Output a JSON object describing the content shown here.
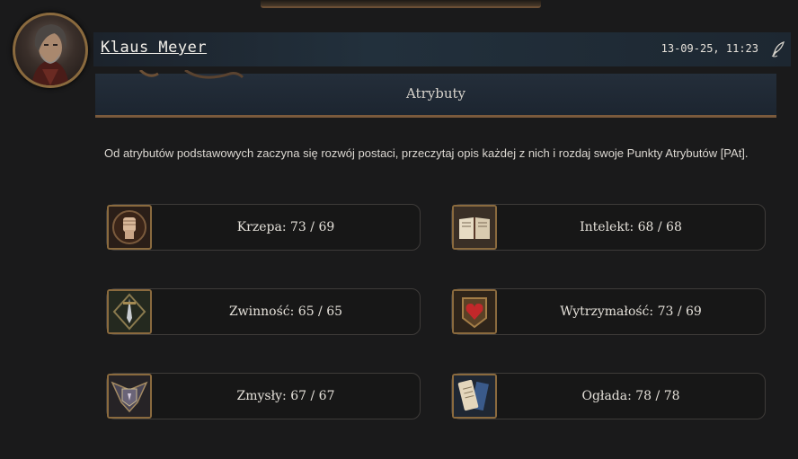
{
  "post": {
    "author": "Klaus Meyer",
    "date": "13-09-25, 11:23"
  },
  "section": {
    "title": "Atrybuty"
  },
  "description": "Od atrybutów podstawowych zaczyna się rozwój postaci, przeczytaj opis każdej z nich i rozdaj swoje Punkty Atrybutów [PAt].",
  "attributes": [
    {
      "label": "Krzepa: 73 / 69",
      "icon": "fist-icon"
    },
    {
      "label": "Intelekt: 68 / 68",
      "icon": "book-icon"
    },
    {
      "label": "Zwinność: 65 / 65",
      "icon": "sword-icon"
    },
    {
      "label": "Wytrzymałość: 73 / 69",
      "icon": "heart-icon"
    },
    {
      "label": "Zmysły: 67 / 67",
      "icon": "eye-shield-icon"
    },
    {
      "label": "Ogłada: 78 / 78",
      "icon": "scroll-icon"
    }
  ],
  "colors": {
    "background": "#1a1a1b",
    "accent": "#8a6a3e",
    "header": "#22303c"
  }
}
